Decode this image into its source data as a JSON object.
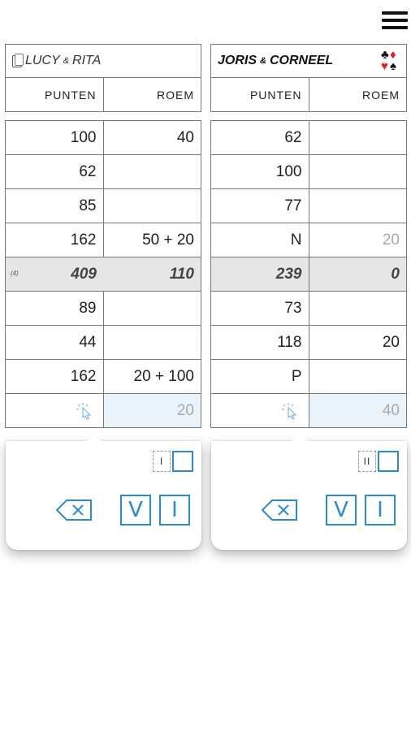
{
  "teams": [
    {
      "name": "LUCY",
      "amp": "&",
      "partner": "RITA",
      "col_punten": "PUNTEN",
      "col_roem": "ROEM",
      "rows": [
        {
          "punten": "100",
          "roem": "40"
        },
        {
          "punten": "62",
          "roem": ""
        },
        {
          "punten": "85",
          "roem": ""
        },
        {
          "punten": "162",
          "roem": "50 + 20"
        },
        {
          "marker": "(4)",
          "punten": "409",
          "roem": "110",
          "total": true
        },
        {
          "punten": "89",
          "roem": ""
        },
        {
          "punten": "44",
          "roem": ""
        },
        {
          "punten": "162",
          "roem": "20 + 100"
        }
      ],
      "input_roem": "20",
      "keypad": {
        "toggle_label": "I",
        "key_v": "V",
        "key_i": "I"
      }
    },
    {
      "name": "JORIS",
      "amp": "&",
      "partner": "CORNEEL",
      "col_punten": "PUNTEN",
      "col_roem": "ROEM",
      "rows": [
        {
          "punten": "62",
          "roem": ""
        },
        {
          "punten": "100",
          "roem": ""
        },
        {
          "punten": "77",
          "roem": ""
        },
        {
          "punten": "N",
          "roem": "20",
          "roem_dim": true
        },
        {
          "marker": "",
          "punten": "239",
          "roem": "0",
          "total": true
        },
        {
          "punten": "73",
          "roem": ""
        },
        {
          "punten": "118",
          "roem": "20"
        },
        {
          "punten": "P",
          "roem": ""
        }
      ],
      "input_roem": "40",
      "keypad": {
        "toggle_label": "II",
        "key_v": "V",
        "key_i": "I"
      }
    }
  ],
  "suits": {
    "club": "♣",
    "diamond": "♦",
    "heart": "♥",
    "spade": "♠"
  },
  "colors": {
    "accent": "#2a8ad4",
    "suit_red": "#e0202a",
    "total_row": "#e6e6e6",
    "input_highlight": "#e8f3fb"
  },
  "icons": {
    "menu": "hamburger-menu-icon",
    "cards": "cards-icon",
    "pointer": "tap-pointer-icon",
    "backspace": "backspace-icon"
  }
}
